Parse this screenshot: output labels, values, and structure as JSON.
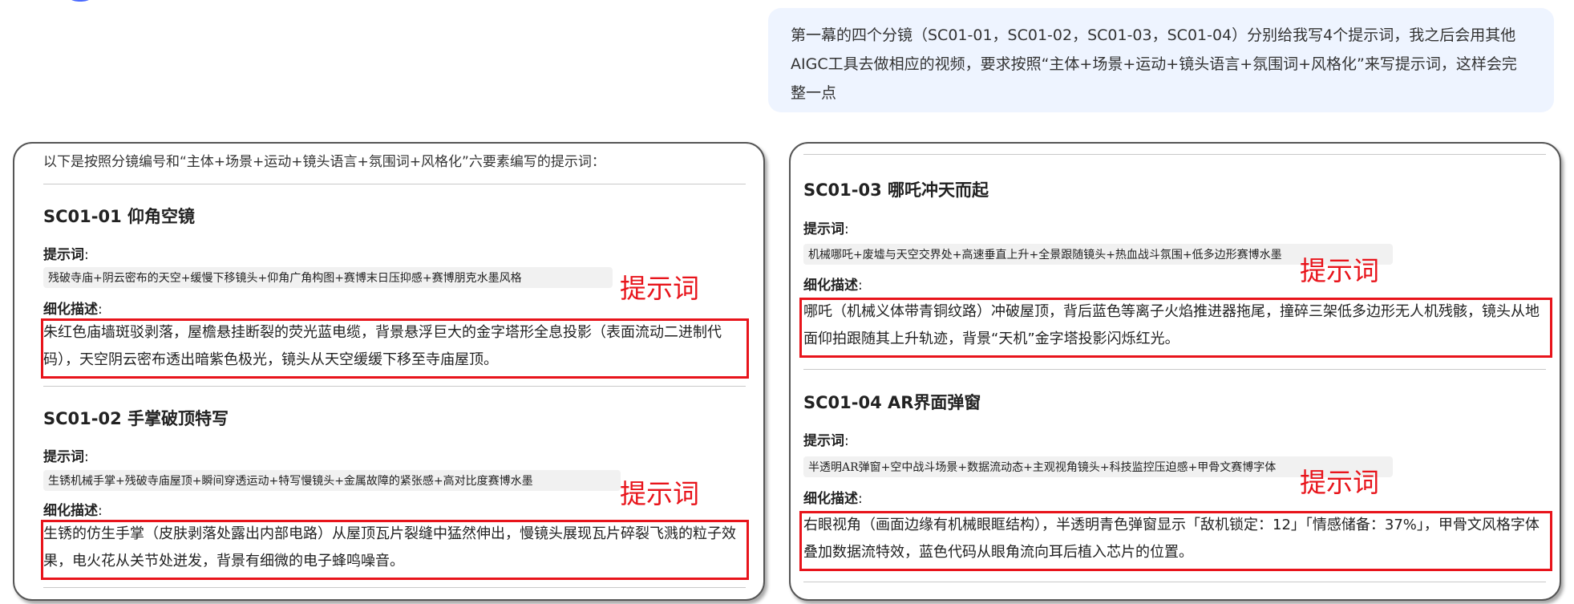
{
  "user_message": {
    "text": "第一幕的四个分镜（SC01-01，SC01-02，SC01-03，SC01-04）分别给我写4个提示词，我之后会用其他AIGC工具去做相应的视频，要求按照“主体+场景+运动+镜头语言+氛围词+风格化”来写提示词，这样会完整一点"
  },
  "labels": {
    "prompt": "提示词",
    "detail": "细化描述",
    "colon": ":",
    "annotation": "提示词"
  },
  "left_panel": {
    "intro": "以下是按照分镜编号和“主体+场景+运动+镜头语言+氛围词+风格化”六要素编写的提示词：",
    "shots": [
      {
        "title": "SC01-01 仰角空镜",
        "prompt": "残破寺庙+阴云密布的天空+缓慢下移镜头+仰角广角构图+赛博末日压抑感+赛博朋克水墨风格",
        "detail": "朱红色庙墙斑驳剥落，屋檐悬挂断裂的荧光蓝电缆，背景悬浮巨大的金字塔形全息投影（表面流动二进制代码），天空阴云密布透出暗紫色极光，镜头从天空缓缓下移至寺庙屋顶。"
      },
      {
        "title": "SC01-02 手掌破顶特写",
        "prompt": "生锈机械手掌+残破寺庙屋顶+瞬间穿透运动+特写慢镜头+金属故障的紧张感+高对比度赛博水墨",
        "detail": "生锈的仿生手掌（皮肤剥落处露出内部电路）从屋顶瓦片裂缝中猛然伸出，慢镜头展现瓦片碎裂飞溅的粒子效果，电火花从关节处迸发，背景有细微的电子蜂鸣噪音。"
      }
    ]
  },
  "right_panel": {
    "shots": [
      {
        "title": "SC01-03 哪吒冲天而起",
        "prompt": "机械哪吒+废墟与天空交界处+高速垂直上升+全景跟随镜头+热血战斗氛围+低多边形赛博水墨",
        "detail": "哪吒（机械义体带青铜纹路）冲破屋顶，背后蓝色等离子火焰推进器拖尾，撞碎三架低多边形无人机残骸，镜头从地面仰拍跟随其上升轨迹，背景“天机”金字塔投影闪烁红光。"
      },
      {
        "title": "SC01-04 AR界面弹窗",
        "prompt": "半透明AR弹窗+空中战斗场景+数据流动态+主观视角镜头+科技监控压迫感+甲骨文赛博字体",
        "detail": "右眼视角（画面边缘有机械眼眶结构），半透明青色弹窗显示「敌机锁定：12」「情感储备：37%」，甲骨文风格字体叠加数据流特效，蓝色代码从眼角流向耳后植入芯片的位置。"
      }
    ]
  },
  "colors": {
    "accent_red": "#e8141b",
    "bubble_bg": "#eef4ff",
    "chip_bg": "#f1f1f1",
    "avatar_blue": "#4b6bff"
  }
}
